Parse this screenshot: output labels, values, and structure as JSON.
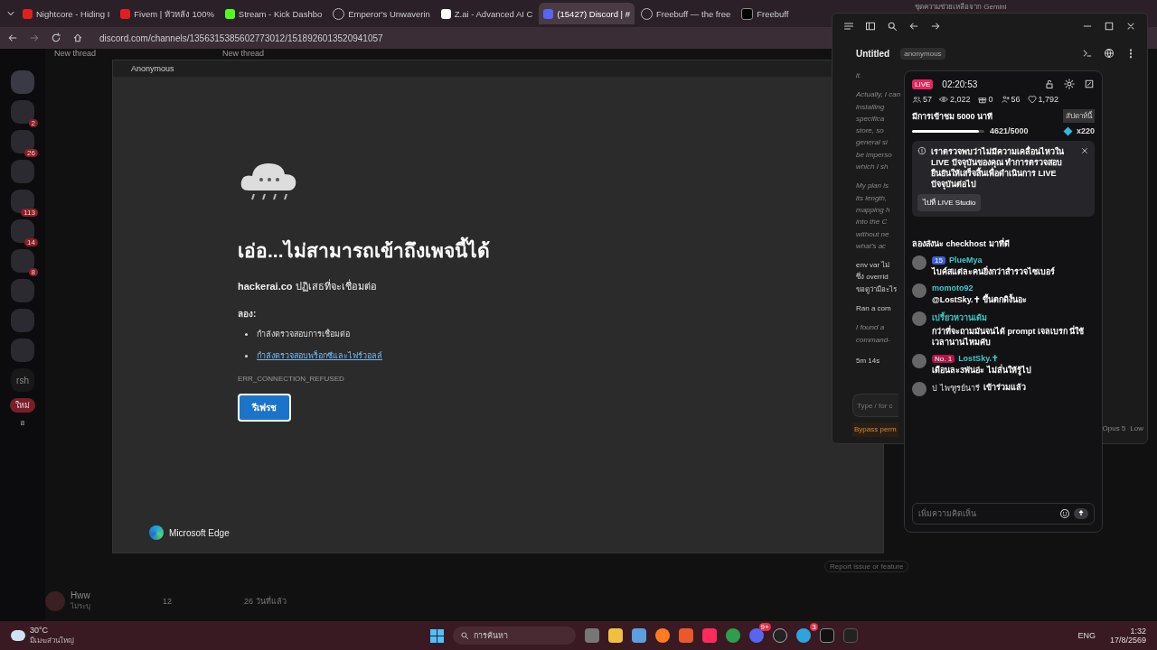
{
  "browser": {
    "tabs": [
      {
        "title": "Nightcore - Hiding I",
        "selected": false,
        "kind": "video"
      },
      {
        "title": "Fivem | หัวหลัง 100%",
        "selected": false,
        "kind": "video"
      },
      {
        "title": "Stream - Kick Dashbo",
        "selected": false,
        "kind": "k"
      },
      {
        "title": "Emperor's Unwaverin",
        "selected": false,
        "kind": "globe"
      },
      {
        "title": "Z.ai - Advanced AI C",
        "selected": false,
        "kind": "z"
      },
      {
        "title": "(15427) Discord | #",
        "selected": true,
        "kind": "chat"
      },
      {
        "title": "Freebuff — the free",
        "selected": false,
        "kind": "globe"
      },
      {
        "title": "Freebuff",
        "selected": false,
        "kind": "term"
      }
    ],
    "address": "discord.com/channels/1356315385602773012/1518926013520941057",
    "gemini_tab": "ชุดความช่วยเหลือจาก Gemini"
  },
  "discord": {
    "threads": [
      "New thread",
      "New thread"
    ],
    "servers": [
      {
        "kind": "badged",
        "badge": "2"
      },
      {
        "kind": "badged",
        "badge": "26"
      },
      {
        "kind": "plain"
      },
      {
        "kind": "badged",
        "badge": "113"
      },
      {
        "kind": "badged",
        "badge": "14"
      },
      {
        "kind": "badged",
        "badge": "8"
      },
      {
        "kind": "plain"
      },
      {
        "kind": "plain"
      },
      {
        "kind": "plain"
      }
    ],
    "folder_label": "rsh",
    "new_label": "ใหม่",
    "new_count": "8",
    "user": {
      "name": "Hww",
      "status": "ไม่ระบุ"
    },
    "thread_meta": {
      "count": "12",
      "age": "26 วันที่แล้ว"
    },
    "report": "Report issue or feature"
  },
  "edge": {
    "title": "Anonymous",
    "heading": "เอ่อ...ไม่สามารถเข้าถึงเพจนี้ได้",
    "subtitle": "**hackerai.co** ปฏิเสธที่จะเชื่อมต่อ",
    "try_label": "ลอง:",
    "suggestions": [
      {
        "text": "กำลังตรวจสอบการเชื่อมต่อ",
        "kind": "text"
      },
      {
        "text": "กำลังตรวจสอบพร็อกซีและไฟร์วอลล์",
        "kind": "link"
      }
    ],
    "error_code": "ERR_CONNECTION_REFUSED",
    "button": "รีเฟรช",
    "brand": "Microsoft Edge"
  },
  "agent": {
    "title": "Untitled",
    "badge": "anonymous",
    "first_line": "it.",
    "paragraphs": [
      [
        "Actually, I can",
        "installing",
        "specifica",
        "store, so",
        "general si",
        "be imperso",
        "which I sh"
      ],
      [
        "My plan is",
        "its length,",
        "mapping h",
        "into the C",
        "without ne",
        "what's ac"
      ],
      [
        "env var ไม่",
        "ซึ่ง overrid",
        "ขอดูว่ามีอะไร"
      ]
    ],
    "command": "Ran a com",
    "found": [
      "I found a",
      "command-"
    ],
    "timer": "5m 14s",
    "input_placeholder": "Type / for c",
    "bypass": "Bypass perm",
    "model": "Opus 5",
    "effort": "Low"
  },
  "live": {
    "badge": "LIVE",
    "time": "02:20:53",
    "stats": [
      {
        "kind": "viewers",
        "value": "57"
      },
      {
        "kind": "views",
        "value": "2,022"
      },
      {
        "kind": "gifts",
        "value": "0"
      },
      {
        "kind": "follows",
        "value": "56"
      },
      {
        "kind": "likes",
        "value": "1,792"
      }
    ],
    "goal": {
      "label": "มีการเข้าชม 5000 นาที",
      "period": "สัปดาห์นี้",
      "level": 0.92,
      "reading": "4621/5000",
      "multiplier": "x220"
    },
    "notice": {
      "text": "เราตรวจพบว่าไม่มีความเคลื่อนไหวใน LIVE ปัจจุบันของคุณ ทำการตรวจสอบยืนยันให้เสร็จสิ้นเพื่อดำเนินการ LIVE ปัจจุบันต่อไป",
      "button": "ไปที่ LIVE Studio"
    },
    "comments": [
      {
        "kind": "message",
        "text": "ลองส่งนะ checkhost มาที่ดี"
      },
      {
        "kind": "message",
        "name": "PlueMya",
        "badge": {
          "kind": "level",
          "text": "15"
        },
        "text": "ไบค์สแต่ละคนยิ่งกว่าสำรวจไซเบอร์"
      },
      {
        "kind": "message",
        "name": "momoto92",
        "text": "@LostSky.✝ ขึ้นตกดิงั้นอะ"
      },
      {
        "kind": "message",
        "name": "เปรี้ยวหวานเด้ม",
        "text": "กว่าที่จะถามมันจนได้ prompt เจลเบรก นี่ใช้เวลานานไหมคับ"
      },
      {
        "kind": "message",
        "name": "LostSky.✝",
        "badge": {
          "kind": "rank",
          "text": "No. 1"
        },
        "text": "เดือนละ3พันอ่ะ ไม่ลั่นให้รู้ไป"
      },
      {
        "kind": "join",
        "name": "ป ไพฑูรย์นารี",
        "text": "เข้าร่วมแล้ว"
      }
    ],
    "input_placeholder": "เพิ่มความคิดเห็น"
  },
  "taskbar": {
    "temp": "30°C",
    "weather": "มีเมฆส่วนใหญ่",
    "search": "การค้นหา",
    "apps": [
      {
        "kind": "files"
      },
      {
        "kind": "folder"
      },
      {
        "kind": "notes"
      },
      {
        "kind": "browser"
      },
      {
        "kind": "star"
      },
      {
        "kind": "music"
      },
      {
        "kind": "chrome"
      },
      {
        "kind": "chat",
        "badge": "9+"
      },
      {
        "kind": "clock"
      },
      {
        "kind": "send",
        "badge": "3"
      },
      {
        "kind": "term"
      },
      {
        "kind": "user"
      }
    ],
    "lang": "ENG",
    "time": "1:32",
    "date": "17/8/2569"
  }
}
